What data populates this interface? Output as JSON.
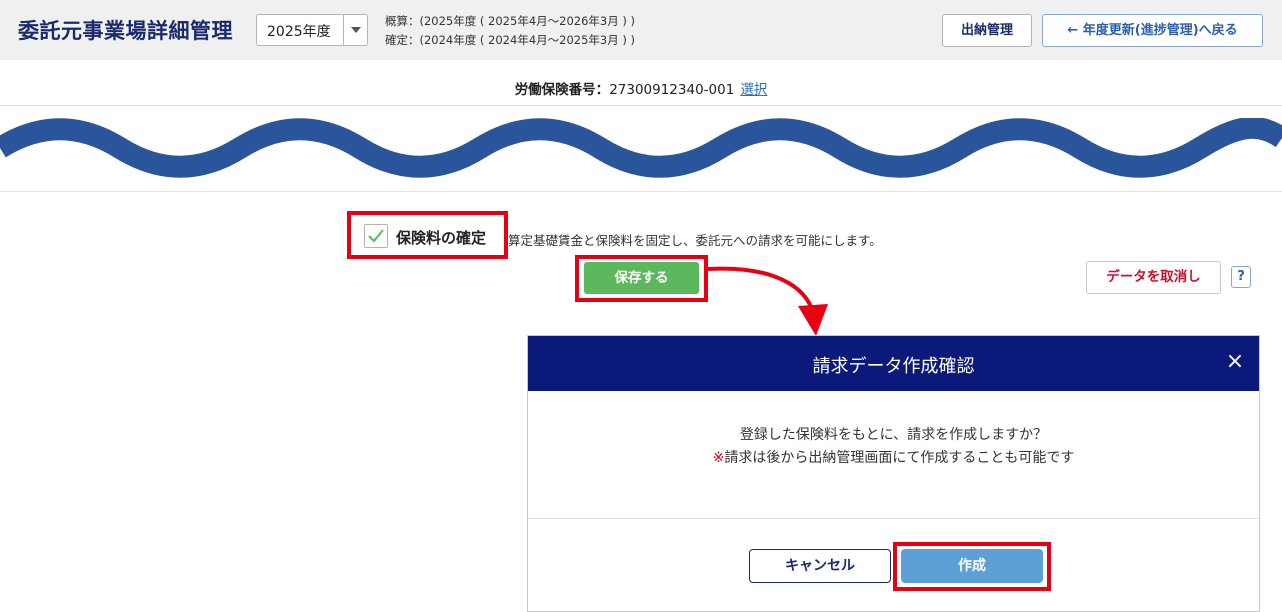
{
  "header": {
    "title": "委託元事業場詳細管理",
    "year_select": "2025年度",
    "period_estimate": "概算：(2025年度 ( 2025年4月～2026年3月 ) )",
    "period_confirm": "確定：(2024年度 ( 2024年4月～2025年3月 ) )",
    "suino_button": "出納管理",
    "back_button": "← 年度更新(進捗管理)へ戻る"
  },
  "insurance": {
    "label": "労働保険番号：",
    "number": "27300912340-001",
    "select_link": "選択"
  },
  "confirm": {
    "checked": true,
    "label": "保険料の確定",
    "description": "算定基礎賃金と保険料を固定し、委託元への請求を可能にします。",
    "save_button": "保存する",
    "cancel_data_button": "データを取消し",
    "help": "?"
  },
  "modal": {
    "title": "請求データ作成確認",
    "close": "×",
    "message": "登録した保険料をもとに、請求を作成しますか？",
    "note_mark": "※",
    "note": "請求は後から出納管理画面にて作成することも可能です",
    "cancel_button": "キャンセル",
    "create_button": "作成"
  },
  "colors": {
    "navy": "#1a2b6d",
    "modal_header": "#0b1a7a",
    "save_green": "#5cb85c",
    "create_blue": "#5da0d8",
    "highlight_red": "#e60012",
    "wave_blue": "#2b559a"
  },
  "icons": {
    "checkbox": "check-icon",
    "back": "arrow-left-icon",
    "select": "caret-down-icon",
    "close": "close-icon",
    "help": "question-icon"
  }
}
